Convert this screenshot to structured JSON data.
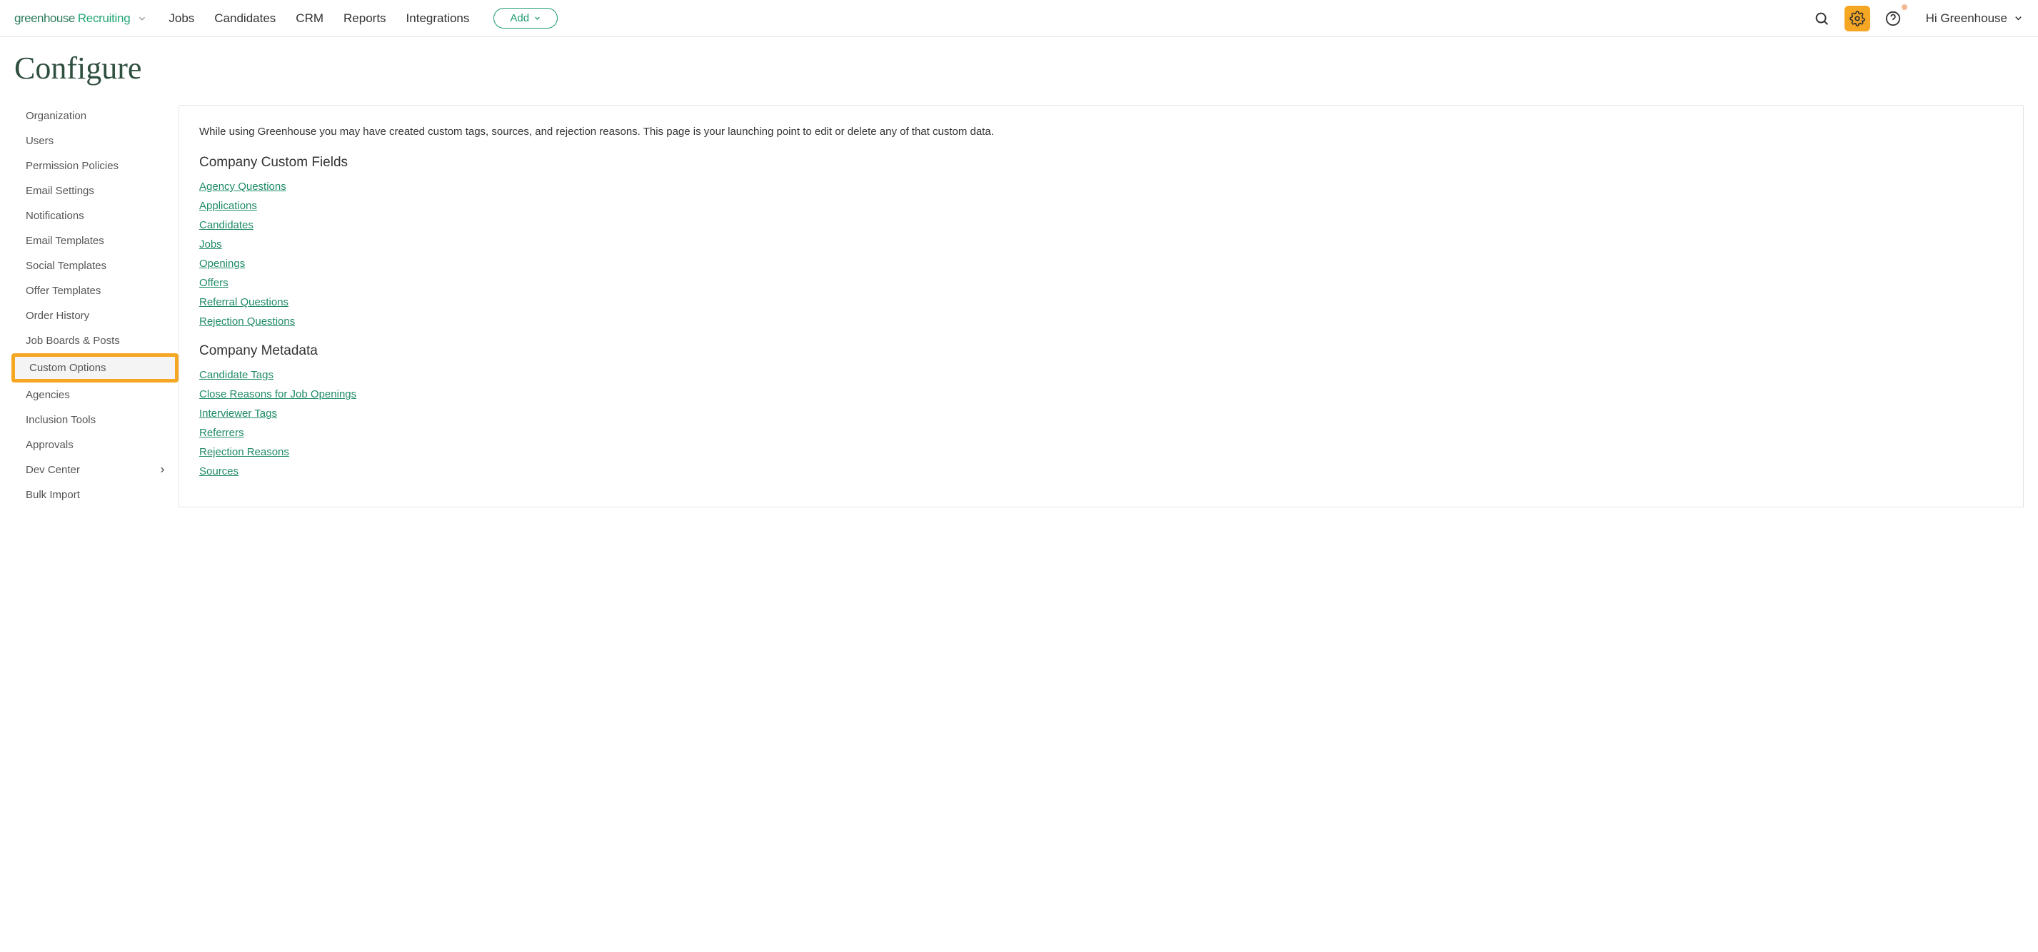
{
  "header": {
    "logo_primary": "greenhouse",
    "logo_secondary": "Recruiting",
    "nav": [
      "Jobs",
      "Candidates",
      "CRM",
      "Reports",
      "Integrations"
    ],
    "add_label": "Add",
    "user_label": "Hi Greenhouse"
  },
  "page_title": "Configure",
  "sidebar": {
    "items": [
      {
        "label": "Organization"
      },
      {
        "label": "Users"
      },
      {
        "label": "Permission Policies"
      },
      {
        "label": "Email Settings"
      },
      {
        "label": "Notifications"
      },
      {
        "label": "Email Templates"
      },
      {
        "label": "Social Templates"
      },
      {
        "label": "Offer Templates"
      },
      {
        "label": "Order History"
      },
      {
        "label": "Job Boards & Posts"
      },
      {
        "label": "Custom Options",
        "highlighted": true
      },
      {
        "label": "Agencies"
      },
      {
        "label": "Inclusion Tools"
      },
      {
        "label": "Approvals"
      },
      {
        "label": "Dev Center",
        "has_chevron": true
      },
      {
        "label": "Bulk Import"
      }
    ]
  },
  "main": {
    "intro": "While using Greenhouse you may have created custom tags, sources, and rejection reasons. This page is your launching point to edit or delete any of that custom data.",
    "section1_title": "Company Custom Fields",
    "section1_links": [
      "Agency Questions",
      "Applications",
      "Candidates",
      "Jobs",
      "Openings",
      "Offers",
      "Referral Questions",
      "Rejection Questions"
    ],
    "section2_title": "Company Metadata",
    "section2_links": [
      "Candidate Tags",
      "Close Reasons for Job Openings",
      "Interviewer Tags",
      "Referrers",
      "Rejection Reasons",
      "Sources"
    ]
  }
}
